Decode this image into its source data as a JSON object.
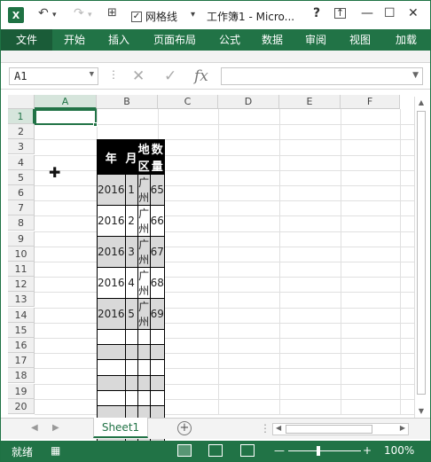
{
  "titlebar": {
    "logo": "X",
    "undo_icon": "undo-icon",
    "redo_icon": "redo-icon",
    "gridlines_check": "✓",
    "gridlines_label": "网格线",
    "title": "工作簿1 - Micro...",
    "help": "?",
    "minimize": "—",
    "restore": "☐",
    "close": "✕"
  },
  "ribbon_tabs": [
    "文件",
    "开始",
    "插入",
    "页面布局",
    "公式",
    "数据",
    "审阅",
    "视图",
    "加载"
  ],
  "formula_bar": {
    "name_box": "A1",
    "cancel_icon": "✕",
    "enter_icon": "✓",
    "fx_label": "fx",
    "formula": ""
  },
  "columns": [
    "A",
    "B",
    "C",
    "D",
    "E",
    "F"
  ],
  "rows": [
    "1",
    "2",
    "3",
    "4",
    "5",
    "6",
    "7",
    "8",
    "9",
    "10",
    "11",
    "12",
    "13",
    "14",
    "15",
    "16",
    "17",
    "18",
    "19",
    "20"
  ],
  "table": {
    "headers": [
      "年",
      "月",
      "地区",
      "数量"
    ],
    "rows": [
      [
        "2016",
        "1",
        "广州",
        "65"
      ],
      [
        "2016",
        "2",
        "广州",
        "66"
      ],
      [
        "2016",
        "3",
        "广州",
        "67"
      ],
      [
        "2016",
        "4",
        "广州",
        "68"
      ],
      [
        "2016",
        "5",
        "广州",
        "69"
      ]
    ]
  },
  "sheet_tabs": {
    "active": "Sheet1",
    "add": "+"
  },
  "status_bar": {
    "status": "就绪",
    "zoom": "100%",
    "zoom_out": "—",
    "zoom_in": "+"
  },
  "colors": {
    "accent": "#217346",
    "header_fill": "#000000",
    "band_fill": "#d9d9d9"
  }
}
